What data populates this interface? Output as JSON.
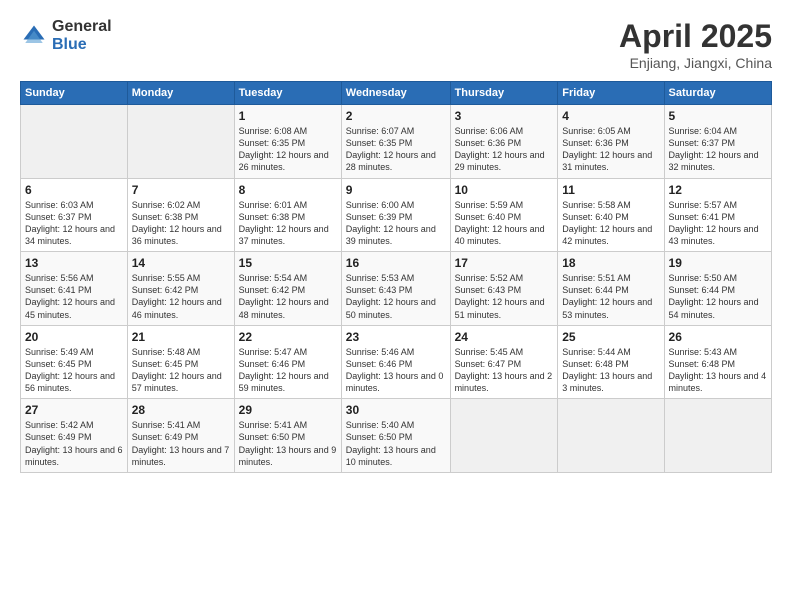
{
  "header": {
    "logo_general": "General",
    "logo_blue": "Blue",
    "month_title": "April 2025",
    "location": "Enjiang, Jiangxi, China"
  },
  "weekdays": [
    "Sunday",
    "Monday",
    "Tuesday",
    "Wednesday",
    "Thursday",
    "Friday",
    "Saturday"
  ],
  "weeks": [
    [
      {
        "day": "",
        "sunrise": "",
        "sunset": "",
        "daylight": ""
      },
      {
        "day": "",
        "sunrise": "",
        "sunset": "",
        "daylight": ""
      },
      {
        "day": "1",
        "sunrise": "Sunrise: 6:08 AM",
        "sunset": "Sunset: 6:35 PM",
        "daylight": "Daylight: 12 hours and 26 minutes."
      },
      {
        "day": "2",
        "sunrise": "Sunrise: 6:07 AM",
        "sunset": "Sunset: 6:35 PM",
        "daylight": "Daylight: 12 hours and 28 minutes."
      },
      {
        "day": "3",
        "sunrise": "Sunrise: 6:06 AM",
        "sunset": "Sunset: 6:36 PM",
        "daylight": "Daylight: 12 hours and 29 minutes."
      },
      {
        "day": "4",
        "sunrise": "Sunrise: 6:05 AM",
        "sunset": "Sunset: 6:36 PM",
        "daylight": "Daylight: 12 hours and 31 minutes."
      },
      {
        "day": "5",
        "sunrise": "Sunrise: 6:04 AM",
        "sunset": "Sunset: 6:37 PM",
        "daylight": "Daylight: 12 hours and 32 minutes."
      }
    ],
    [
      {
        "day": "6",
        "sunrise": "Sunrise: 6:03 AM",
        "sunset": "Sunset: 6:37 PM",
        "daylight": "Daylight: 12 hours and 34 minutes."
      },
      {
        "day": "7",
        "sunrise": "Sunrise: 6:02 AM",
        "sunset": "Sunset: 6:38 PM",
        "daylight": "Daylight: 12 hours and 36 minutes."
      },
      {
        "day": "8",
        "sunrise": "Sunrise: 6:01 AM",
        "sunset": "Sunset: 6:38 PM",
        "daylight": "Daylight: 12 hours and 37 minutes."
      },
      {
        "day": "9",
        "sunrise": "Sunrise: 6:00 AM",
        "sunset": "Sunset: 6:39 PM",
        "daylight": "Daylight: 12 hours and 39 minutes."
      },
      {
        "day": "10",
        "sunrise": "Sunrise: 5:59 AM",
        "sunset": "Sunset: 6:40 PM",
        "daylight": "Daylight: 12 hours and 40 minutes."
      },
      {
        "day": "11",
        "sunrise": "Sunrise: 5:58 AM",
        "sunset": "Sunset: 6:40 PM",
        "daylight": "Daylight: 12 hours and 42 minutes."
      },
      {
        "day": "12",
        "sunrise": "Sunrise: 5:57 AM",
        "sunset": "Sunset: 6:41 PM",
        "daylight": "Daylight: 12 hours and 43 minutes."
      }
    ],
    [
      {
        "day": "13",
        "sunrise": "Sunrise: 5:56 AM",
        "sunset": "Sunset: 6:41 PM",
        "daylight": "Daylight: 12 hours and 45 minutes."
      },
      {
        "day": "14",
        "sunrise": "Sunrise: 5:55 AM",
        "sunset": "Sunset: 6:42 PM",
        "daylight": "Daylight: 12 hours and 46 minutes."
      },
      {
        "day": "15",
        "sunrise": "Sunrise: 5:54 AM",
        "sunset": "Sunset: 6:42 PM",
        "daylight": "Daylight: 12 hours and 48 minutes."
      },
      {
        "day": "16",
        "sunrise": "Sunrise: 5:53 AM",
        "sunset": "Sunset: 6:43 PM",
        "daylight": "Daylight: 12 hours and 50 minutes."
      },
      {
        "day": "17",
        "sunrise": "Sunrise: 5:52 AM",
        "sunset": "Sunset: 6:43 PM",
        "daylight": "Daylight: 12 hours and 51 minutes."
      },
      {
        "day": "18",
        "sunrise": "Sunrise: 5:51 AM",
        "sunset": "Sunset: 6:44 PM",
        "daylight": "Daylight: 12 hours and 53 minutes."
      },
      {
        "day": "19",
        "sunrise": "Sunrise: 5:50 AM",
        "sunset": "Sunset: 6:44 PM",
        "daylight": "Daylight: 12 hours and 54 minutes."
      }
    ],
    [
      {
        "day": "20",
        "sunrise": "Sunrise: 5:49 AM",
        "sunset": "Sunset: 6:45 PM",
        "daylight": "Daylight: 12 hours and 56 minutes."
      },
      {
        "day": "21",
        "sunrise": "Sunrise: 5:48 AM",
        "sunset": "Sunset: 6:45 PM",
        "daylight": "Daylight: 12 hours and 57 minutes."
      },
      {
        "day": "22",
        "sunrise": "Sunrise: 5:47 AM",
        "sunset": "Sunset: 6:46 PM",
        "daylight": "Daylight: 12 hours and 59 minutes."
      },
      {
        "day": "23",
        "sunrise": "Sunrise: 5:46 AM",
        "sunset": "Sunset: 6:46 PM",
        "daylight": "Daylight: 13 hours and 0 minutes."
      },
      {
        "day": "24",
        "sunrise": "Sunrise: 5:45 AM",
        "sunset": "Sunset: 6:47 PM",
        "daylight": "Daylight: 13 hours and 2 minutes."
      },
      {
        "day": "25",
        "sunrise": "Sunrise: 5:44 AM",
        "sunset": "Sunset: 6:48 PM",
        "daylight": "Daylight: 13 hours and 3 minutes."
      },
      {
        "day": "26",
        "sunrise": "Sunrise: 5:43 AM",
        "sunset": "Sunset: 6:48 PM",
        "daylight": "Daylight: 13 hours and 4 minutes."
      }
    ],
    [
      {
        "day": "27",
        "sunrise": "Sunrise: 5:42 AM",
        "sunset": "Sunset: 6:49 PM",
        "daylight": "Daylight: 13 hours and 6 minutes."
      },
      {
        "day": "28",
        "sunrise": "Sunrise: 5:41 AM",
        "sunset": "Sunset: 6:49 PM",
        "daylight": "Daylight: 13 hours and 7 minutes."
      },
      {
        "day": "29",
        "sunrise": "Sunrise: 5:41 AM",
        "sunset": "Sunset: 6:50 PM",
        "daylight": "Daylight: 13 hours and 9 minutes."
      },
      {
        "day": "30",
        "sunrise": "Sunrise: 5:40 AM",
        "sunset": "Sunset: 6:50 PM",
        "daylight": "Daylight: 13 hours and 10 minutes."
      },
      {
        "day": "",
        "sunrise": "",
        "sunset": "",
        "daylight": ""
      },
      {
        "day": "",
        "sunrise": "",
        "sunset": "",
        "daylight": ""
      },
      {
        "day": "",
        "sunrise": "",
        "sunset": "",
        "daylight": ""
      }
    ]
  ]
}
